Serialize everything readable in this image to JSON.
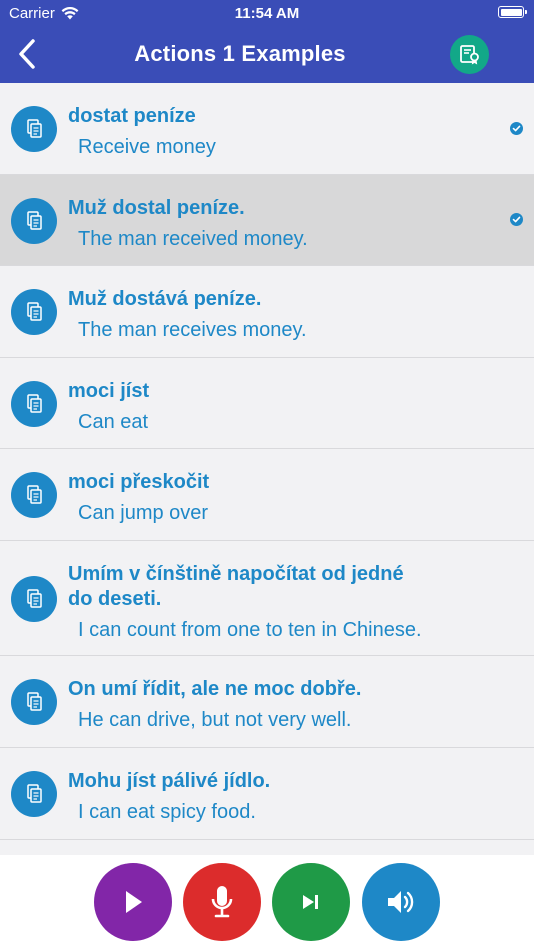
{
  "status_bar": {
    "carrier": "Carrier",
    "time": "11:54 AM"
  },
  "header": {
    "title": "Actions 1 Examples",
    "background": "#3a4db7",
    "back_icon": "chevron-left-icon",
    "action_icon": "certificate-icon"
  },
  "colors": {
    "accent": "#1e88c7",
    "row_selected": "#d8d8d9",
    "play": "#8226a8",
    "record": "#dc2c2c",
    "next": "#1f9a47",
    "sound": "#1e88c7",
    "certificate": "#12a888"
  },
  "examples": [
    {
      "czech": "dostat peníze",
      "english": "Receive money",
      "checked": true,
      "selected": false
    },
    {
      "czech": "Muž dostal peníze.",
      "english": "The man received money.",
      "checked": true,
      "selected": true
    },
    {
      "czech": "Muž dostává peníze.",
      "english": "The man receives money.",
      "checked": false,
      "selected": false
    },
    {
      "czech": "moci jíst",
      "english": "Can eat",
      "checked": false,
      "selected": false
    },
    {
      "czech": "moci přeskočit",
      "english": "Can jump over",
      "checked": false,
      "selected": false
    },
    {
      "czech": "Umím v čínštině napočítat od jedné\ndo deseti.",
      "english": "I can count from one to ten in Chinese.",
      "checked": false,
      "selected": false
    },
    {
      "czech": "On umí řídit, ale ne moc dobře.",
      "english": "He can drive, but not very well.",
      "checked": false,
      "selected": false
    },
    {
      "czech": "Mohu jíst pálivé jídlo.",
      "english": "I can eat spicy food.",
      "checked": false,
      "selected": false
    }
  ],
  "controls": [
    {
      "icon": "play-icon"
    },
    {
      "icon": "microphone-icon"
    },
    {
      "icon": "skip-next-icon"
    },
    {
      "icon": "speaker-icon"
    }
  ]
}
